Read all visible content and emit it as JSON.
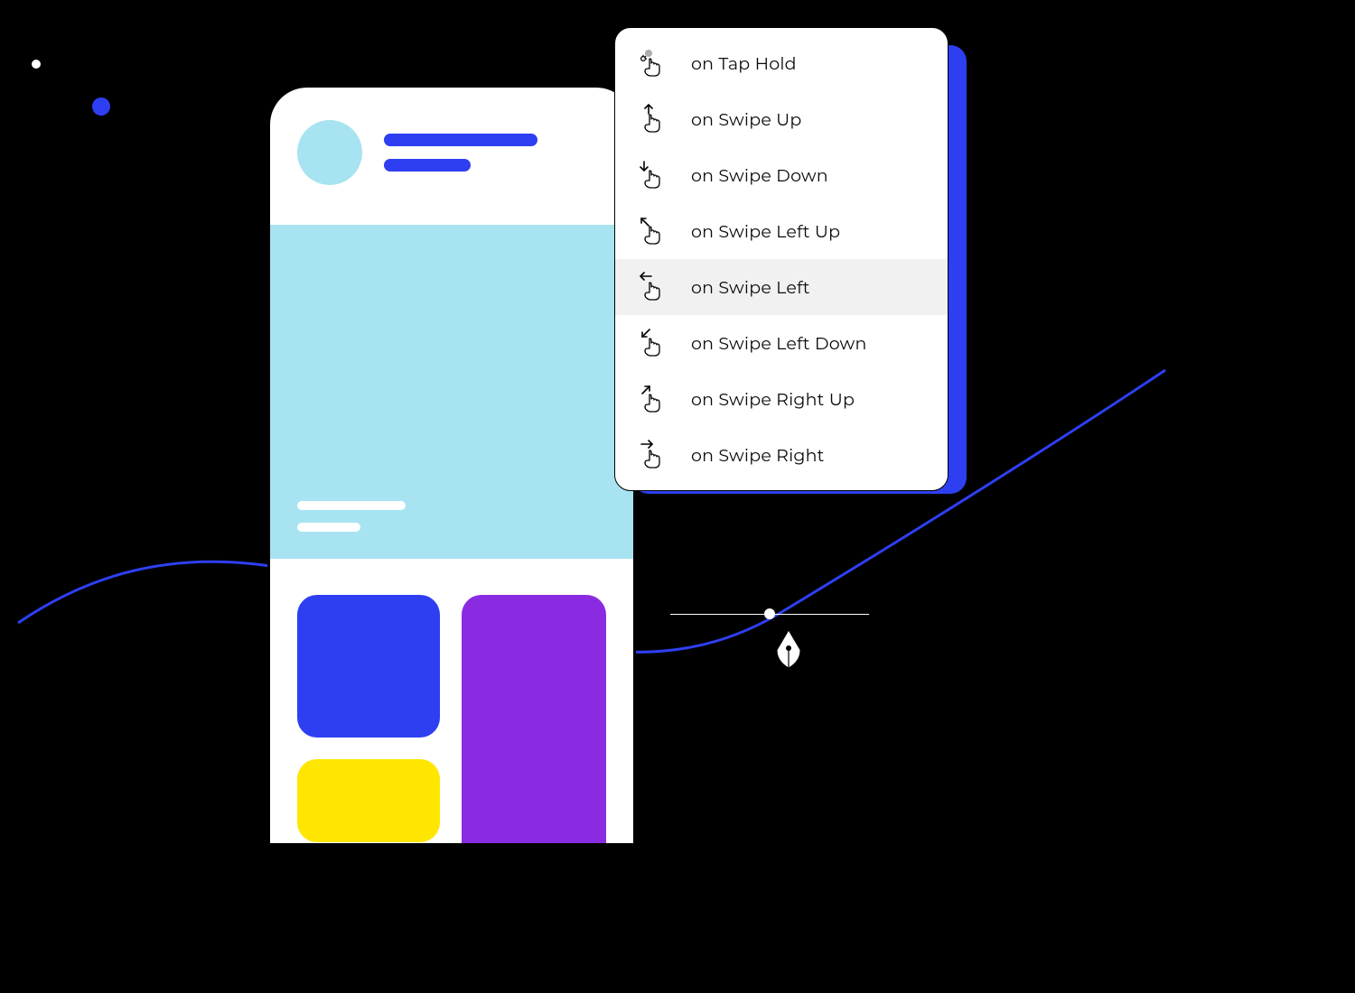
{
  "colors": {
    "brand_blue": "#2E3FF2",
    "sky": "#A7E3F1",
    "purple": "#8A2BE2",
    "yellow": "#FFE600"
  },
  "gesture_menu": {
    "items": [
      {
        "label": "on Tap Hold",
        "icon": "tap-hold-icon",
        "selected": false
      },
      {
        "label": "on Swipe Up",
        "icon": "swipe-up-icon",
        "selected": false
      },
      {
        "label": "on Swipe Down",
        "icon": "swipe-down-icon",
        "selected": false
      },
      {
        "label": "on Swipe Left Up",
        "icon": "swipe-left-up-icon",
        "selected": false
      },
      {
        "label": "on Swipe Left",
        "icon": "swipe-left-icon",
        "selected": true
      },
      {
        "label": "on Swipe Left Down",
        "icon": "swipe-left-down-icon",
        "selected": false
      },
      {
        "label": "on Swipe Right Up",
        "icon": "swipe-right-up-icon",
        "selected": false
      },
      {
        "label": "on Swipe Right",
        "icon": "swipe-right-icon",
        "selected": false
      }
    ]
  }
}
